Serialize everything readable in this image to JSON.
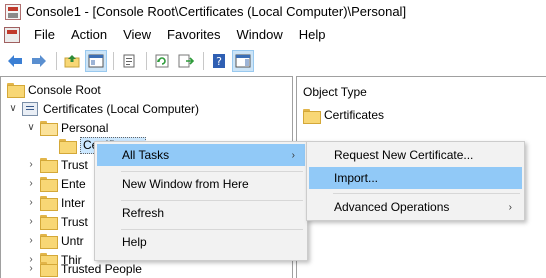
{
  "window": {
    "title": "Console1 - [Console Root\\Certificates (Local Computer)\\Personal]"
  },
  "menubar": {
    "items": [
      "File",
      "Action",
      "View",
      "Favorites",
      "Window",
      "Help"
    ]
  },
  "toolbar": {
    "buttons": [
      "back-icon",
      "forward-icon",
      "up-folder-icon",
      "show-hide-tree-icon",
      "properties-icon",
      "refresh-icon",
      "export-list-icon",
      "help-icon",
      "show-hide-action-pane-icon"
    ]
  },
  "tree": {
    "items": [
      {
        "label": "Console Root"
      },
      {
        "label": "Certificates (Local Computer)"
      },
      {
        "label": "Personal"
      },
      {
        "label": "Certificates"
      },
      {
        "label": "Trust"
      },
      {
        "label": "Ente"
      },
      {
        "label": "Inter"
      },
      {
        "label": "Trust"
      },
      {
        "label": "Untr"
      },
      {
        "label": "Thir"
      },
      {
        "label": "Trusted People"
      }
    ]
  },
  "detail": {
    "column_header": "Object Type",
    "rows": [
      {
        "label": "Certificates"
      }
    ]
  },
  "context_menu": {
    "items": [
      "All Tasks",
      "New Window from Here",
      "Refresh",
      "Help"
    ]
  },
  "submenu": {
    "items": [
      "Request New Certificate...",
      "Import...",
      "Advanced Operations"
    ]
  },
  "colors": {
    "menu_hover": "#91c9f7",
    "selection": "#cce8ff",
    "folder": "#f8d775"
  }
}
